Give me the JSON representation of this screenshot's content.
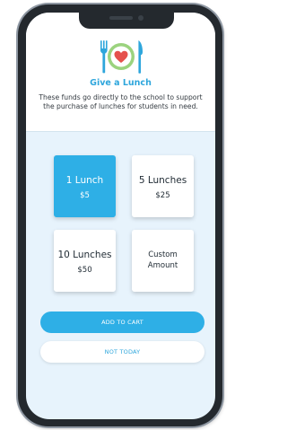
{
  "header": {
    "title": "Give a Lunch",
    "description": "These funds go directly to the school to support the purchase of lunches for students in need."
  },
  "options": [
    {
      "label": "1 Lunch",
      "price": "$5",
      "selected": true
    },
    {
      "label": "5 Lunches",
      "price": "$25",
      "selected": false
    },
    {
      "label": "10 Lunches",
      "price": "$50",
      "selected": false
    },
    {
      "label": "Custom Amount",
      "selected": false
    }
  ],
  "actions": {
    "add_to_cart": "ADD TO CART",
    "not_today": "NOT TODAY"
  },
  "icons": {
    "logo": "fork-heart-plate-knife-icon"
  },
  "colors": {
    "accent": "#2eafe6",
    "heart": "#e5514d",
    "plate_ring": "#9bd37e",
    "background": "#e7f3fc",
    "frame": "#24292e"
  }
}
